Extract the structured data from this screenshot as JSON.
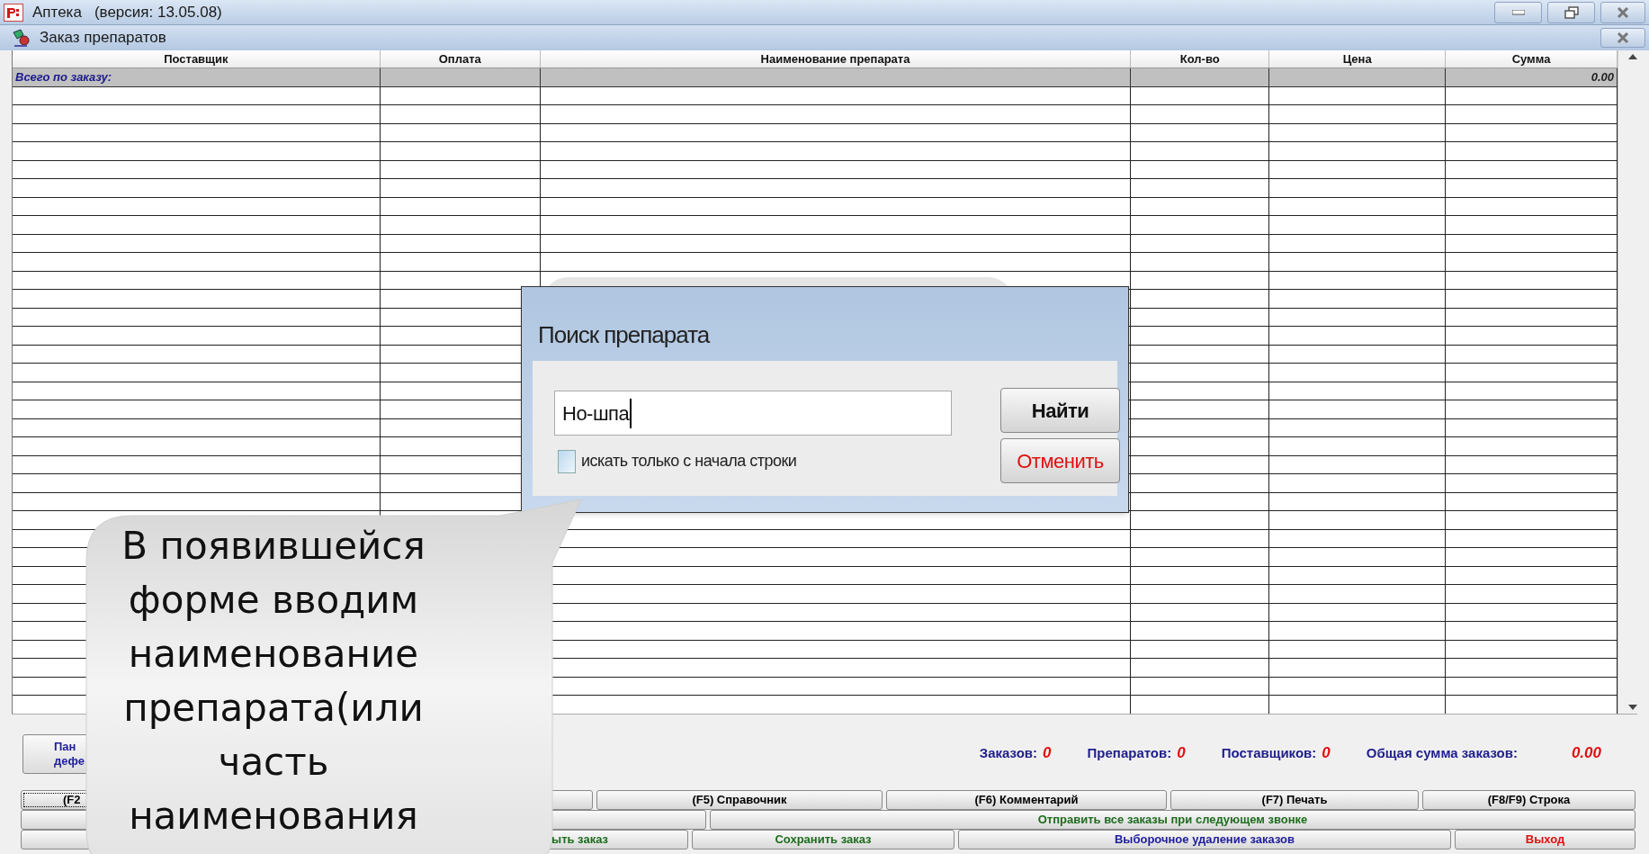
{
  "window": {
    "title": "Аптека",
    "version": "(версия: 13.05.08)"
  },
  "document_window": {
    "title": "Заказ препаратов"
  },
  "table": {
    "columns": [
      "Поставщик",
      "Оплата",
      "Наименование препарата",
      "Кол-во",
      "Цена",
      "Сумма"
    ],
    "total_row": {
      "label": "Всего по заказу:",
      "sum": "0.00"
    }
  },
  "search_dialog": {
    "title": "Поиск препарата",
    "query": "Но-шпа",
    "checkbox": {
      "label": "искать только с начала строки",
      "checked": false
    },
    "buttons": [
      {
        "label": "Найти",
        "kind": "primary"
      },
      {
        "label": "Отменить",
        "kind": "cancel"
      }
    ]
  },
  "side_button": {
    "label": "Пан\nдефе"
  },
  "summary": [
    {
      "label": "Заказов:",
      "value": "0"
    },
    {
      "label": "Препаратов:",
      "value": "0"
    },
    {
      "label": "Поставщиков:",
      "value": "0"
    },
    {
      "label": "Общая сумма заказов:",
      "value": "0.00"
    }
  ],
  "button_rows": [
    [
      {
        "label": "(F2",
        "color": "#000000",
        "focused": true
      },
      {},
      {
        "label": "(F5) Справочник",
        "color": "#000000"
      },
      {
        "label": "(F6) Комментарий",
        "color": "#000000"
      },
      {
        "label": "(F7) Печать",
        "color": "#000000"
      },
      {
        "label": "(F8/F9) Строка",
        "color": "#000000"
      }
    ],
    [
      {},
      {
        "label": "Отправить все заказы при следующем звонке",
        "color": "#1e6b1e"
      }
    ],
    [
      {},
      {
        "label": "ыть заказ",
        "color": "#1e6b1e"
      },
      {
        "label": "Сохранить заказ",
        "color": "#1e6b1e"
      },
      {
        "label": "Выборочное удаление заказов",
        "color": "#1e1e9c"
      },
      {
        "label": "Выход",
        "color": "#e01010"
      }
    ]
  ],
  "callout": {
    "text": "В появившейся\nформе вводим\nнаименование\nпрепарата(или\nчасть\nнаименования"
  }
}
